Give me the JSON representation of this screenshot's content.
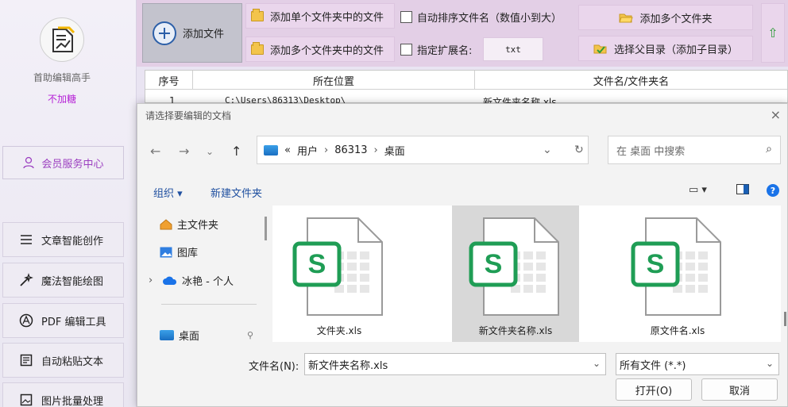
{
  "sidebar": {
    "app_name": "首助编辑高手",
    "slogan": "不加糖",
    "member_center": "会员服务中心",
    "items": [
      {
        "label": "文章智能创作",
        "icon": "list-icon"
      },
      {
        "label": "魔法智能绘图",
        "icon": "magic-wand-icon"
      },
      {
        "label": "PDF 编辑工具",
        "icon": "pdf-icon"
      },
      {
        "label": "自动粘贴文本",
        "icon": "paste-icon"
      },
      {
        "label": "图片批量处理",
        "icon": "image-icon"
      }
    ]
  },
  "toolbar": {
    "add_file": "添加文件",
    "add_single_folder": "添加单个文件夹中的文件",
    "add_multi_folder_files": "添加多个文件夹中的文件",
    "auto_sort": "自动排序文件名（数值小到大）",
    "specify_ext": "指定扩展名:",
    "ext_value": "txt",
    "add_multi_folders": "添加多个文件夹",
    "select_parent": "选择父目录（添加子目录）",
    "up_arrow": "⇧"
  },
  "table": {
    "headers": [
      "序号",
      "所在位置",
      "文件名/文件夹名"
    ],
    "partial_row": {
      "index": "1",
      "location": "C:\\Users\\86313\\Desktop\\",
      "name": "新文件夹名称.xls"
    }
  },
  "dialog": {
    "title": "请选择要编辑的文档",
    "close": "×",
    "address": {
      "prefix": "«",
      "parts": [
        "用户",
        "86313",
        "桌面"
      ],
      "separator": "›"
    },
    "search_placeholder": "在 桌面 中搜索",
    "organize": "组织 ▾",
    "new_folder": "新建文件夹",
    "tree": [
      {
        "label": "主文件夹",
        "icon": "home-icon"
      },
      {
        "label": "图库",
        "icon": "gallery-icon"
      },
      {
        "label": "冰艳 - 个人",
        "icon": "cloud-icon"
      },
      {
        "label": "桌面",
        "icon": "desktop-icon"
      }
    ],
    "files": [
      {
        "name": "文件夹.xls",
        "selected": false
      },
      {
        "name": "新文件夹名称.xls",
        "selected": true
      },
      {
        "name": "原文件名.xls",
        "selected": false
      }
    ],
    "filename_label": "文件名(N):",
    "filename_value": "新文件夹名称.xls",
    "filetype_value": "所有文件 (*.*)",
    "open_button": "打开(O)",
    "cancel_button": "取消"
  },
  "colors": {
    "accent_purple": "#b521d6",
    "toolbar_bg": "#e3cfe6",
    "sheet_green": "#1f9d55",
    "link_blue": "#2050a0"
  }
}
